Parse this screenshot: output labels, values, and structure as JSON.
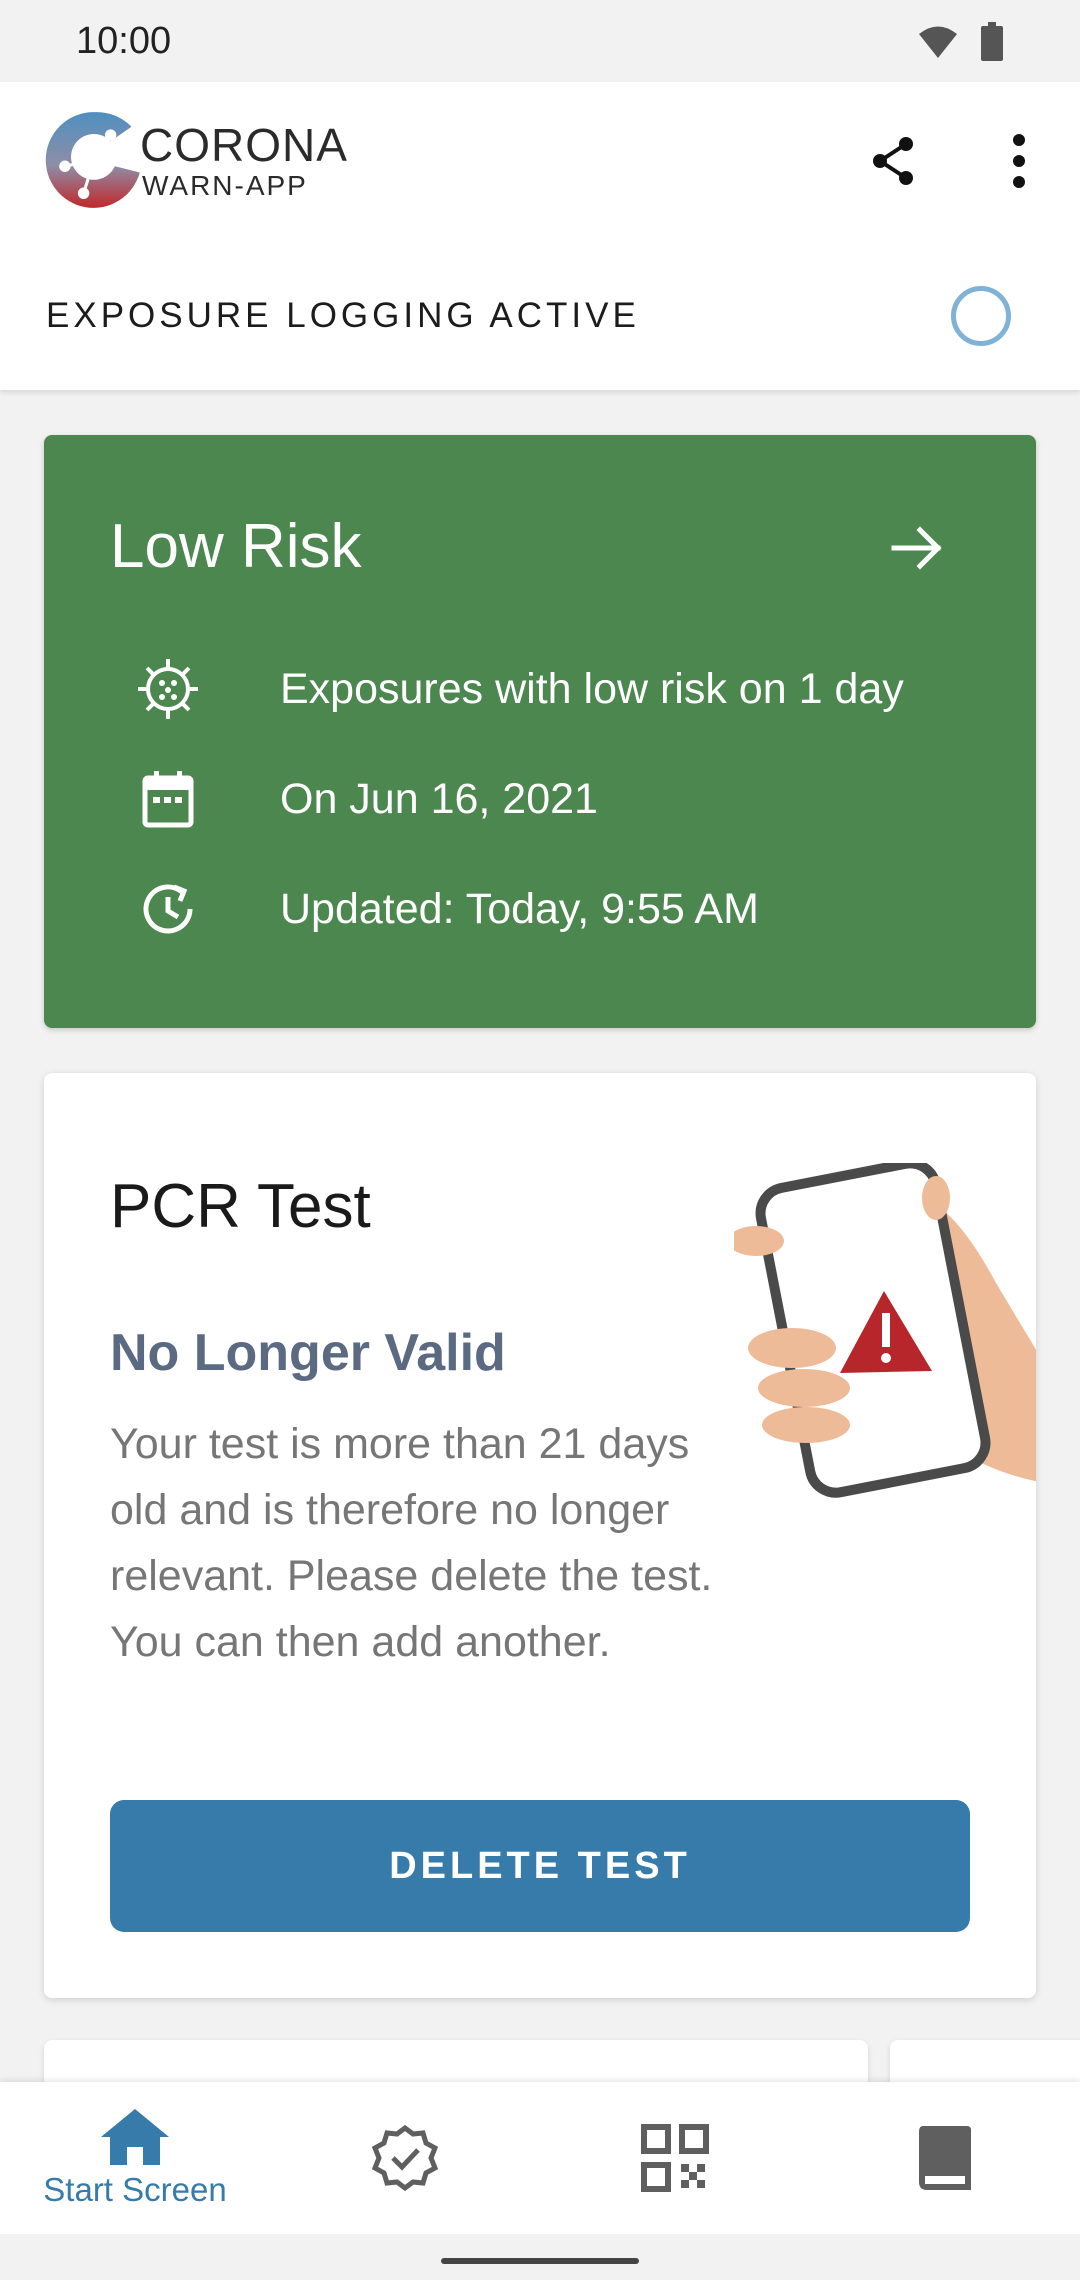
{
  "status_bar": {
    "time": "10:00",
    "icons": [
      "wifi-icon",
      "battery-icon"
    ]
  },
  "header": {
    "logo_title": "CORONA",
    "logo_subtitle": "WARN-APP",
    "actions": [
      "share-icon",
      "more-vert-icon"
    ],
    "exposure_status": "EXPOSURE LOGGING ACTIVE"
  },
  "risk_card": {
    "title": "Low Risk",
    "color": "#4b874f",
    "rows": [
      {
        "icon": "virus-icon",
        "text": "Exposures with low risk on 1 day"
      },
      {
        "icon": "calendar-icon",
        "text": "On Jun 16, 2021"
      },
      {
        "icon": "clock-refresh-icon",
        "text": "Updated: Today, 9:55 AM"
      }
    ]
  },
  "pcr_card": {
    "title": "PCR Test",
    "subtitle": "No Longer Valid",
    "body": "Your test is more than 21 days old and is therefore no longer relevant. Please delete the test. You can then add another.",
    "button_label": "DELETE TEST",
    "button_color": "#367ba9"
  },
  "bottom_nav": {
    "accent": "#367ba9",
    "items": [
      {
        "icon": "home-icon",
        "label": "Start Screen",
        "active": true
      },
      {
        "icon": "certificate-icon",
        "label": "",
        "active": false
      },
      {
        "icon": "qr-code-icon",
        "label": "",
        "active": false
      },
      {
        "icon": "diary-book-icon",
        "label": "",
        "active": false
      }
    ]
  }
}
